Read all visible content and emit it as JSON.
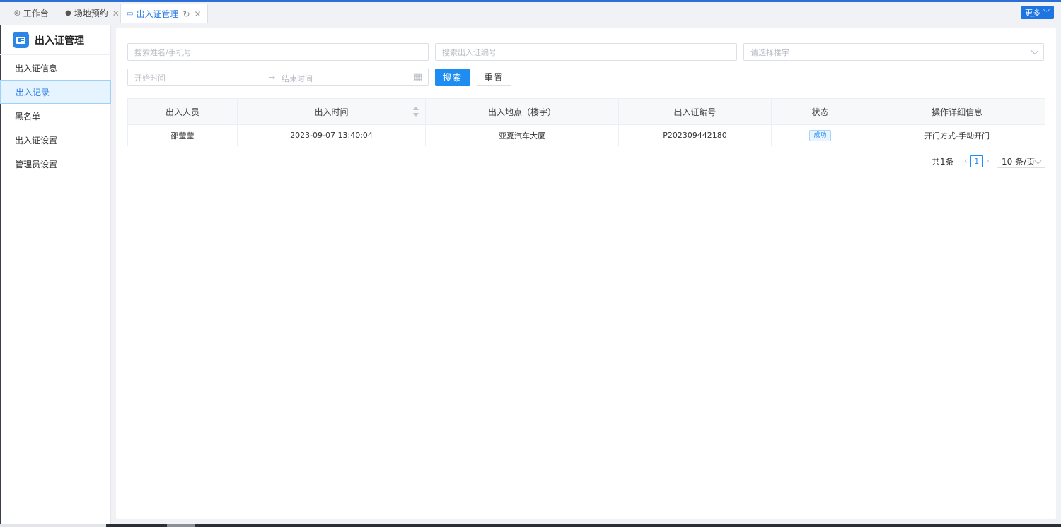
{
  "tabs": [
    {
      "label": "工作台",
      "icon": "dashboard-icon"
    },
    {
      "label": "场地预约",
      "icon": "user-icon"
    },
    {
      "label": "出入证管理",
      "icon": "card-icon"
    }
  ],
  "more_label": "更多",
  "sidebar": {
    "title": "出入证管理",
    "items": [
      {
        "label": "出入证信息"
      },
      {
        "label": "出入记录"
      },
      {
        "label": "黑名单"
      },
      {
        "label": "出入证设置"
      },
      {
        "label": "管理员设置"
      }
    ]
  },
  "filters": {
    "name_placeholder": "搜索姓名/手机号",
    "pass_no_placeholder": "搜索出入证编号",
    "building_placeholder": "请选择楼宇",
    "start_placeholder": "开始时间",
    "end_placeholder": "结束时间",
    "search_label": "搜索",
    "reset_label": "重置"
  },
  "table": {
    "headers": [
      "出入人员",
      "出入时间",
      "出入地点（楼宇）",
      "出入证编号",
      "状态",
      "操作详细信息"
    ],
    "rows": [
      {
        "person": "邵莹莹",
        "time": "2023-09-07 13:40:04",
        "location": "亚夏汽车大厦",
        "pass_no": "P202309442180",
        "status": "成功",
        "detail": "开门方式-手动开门"
      }
    ]
  },
  "pagination": {
    "total": "共1条",
    "current": "1",
    "page_size": "10 条/页"
  },
  "colors": {
    "primary": "#1e8cf0",
    "active_tab": "#2c7be5",
    "header_bar": "#2c6fd6"
  }
}
